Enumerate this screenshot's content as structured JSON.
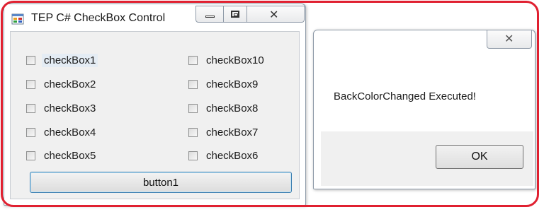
{
  "main_window": {
    "title": "TEP C# CheckBox Control",
    "checkboxes_left": [
      "checkBox1",
      "checkBox2",
      "checkBox3",
      "checkBox4",
      "checkBox5"
    ],
    "checkboxes_right": [
      "checkBox10",
      "checkBox9",
      "checkBox8",
      "checkBox7",
      "checkBox6"
    ],
    "button_label": "button1"
  },
  "message_box": {
    "close_glyph": "✕",
    "message": "BackColorChanged Executed!",
    "ok_label": "OK"
  },
  "icons": {
    "app": "windows-form-icon",
    "minimize": "minimize-icon",
    "maximize": "maximize-icon",
    "close": "close-icon"
  },
  "colors": {
    "annotation_frame": "#e02030",
    "button_focus_border": "#3c7fb1",
    "client_background": "#f0f0f0"
  }
}
